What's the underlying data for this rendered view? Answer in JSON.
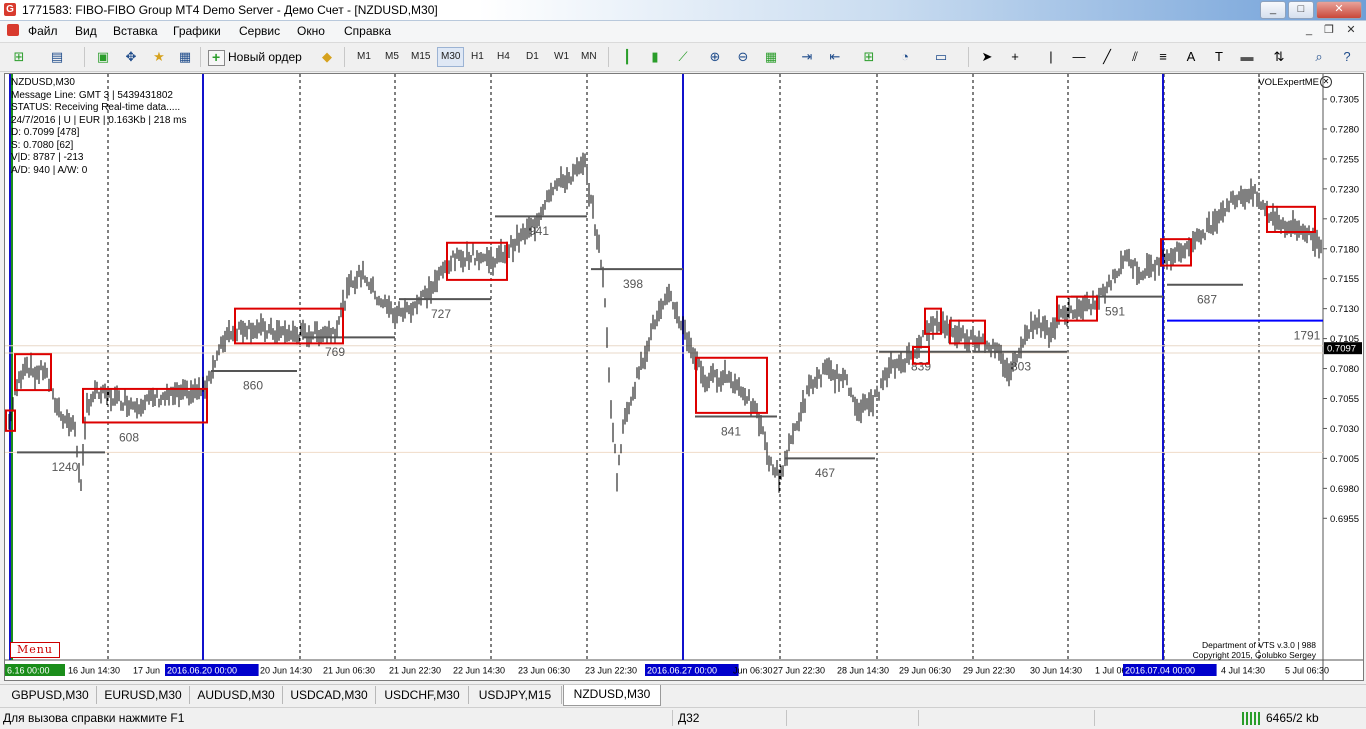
{
  "window": {
    "title": "1771583: FIBO-FIBO Group MT4 Demo Server - Демо Счет - [NZDUSD,M30]",
    "icon_letter": "G",
    "min": "_",
    "max": "□",
    "close": "✕"
  },
  "menu": [
    "Файл",
    "Вид",
    "Вставка",
    "Графики",
    "Сервис",
    "Окно",
    "Справка"
  ],
  "toolbar": {
    "new_order": "Новый ордер",
    "timeframes": [
      "M1",
      "M5",
      "M15",
      "M30",
      "H1",
      "H4",
      "D1",
      "W1",
      "MN"
    ],
    "active_timeframe": "M30"
  },
  "chart": {
    "symbol": "NZDUSD,M30",
    "info": [
      "Message Line: GMT 3 | 5439431802",
      "STATUS:  Receiving Real-time data.....",
      "24/7/2016 | U | EUR | 0.163Kb | 218 ms",
      "D: 0.7099  [478]",
      "S: 0.7080  [62]",
      "V|D: 8787 | -213",
      "A/D: 940  | A/W: 0"
    ],
    "indicator_name": "VOLExpertME",
    "dept_line1": "Department of VTS  v.3.0 | 988",
    "dept_line2": "Copyright 2015, Golubko Sergey",
    "menu_label": "Menu",
    "current_price": "0.7097",
    "price_ticks": [
      "0.7305",
      "0.7280",
      "0.7255",
      "0.7230",
      "0.7205",
      "0.7180",
      "0.7155",
      "0.7130",
      "0.7105",
      "0.7080",
      "0.7055",
      "0.7030",
      "0.7005",
      "0.6980",
      "0.6955"
    ],
    "time_labels": [
      "6.16 00:00",
      "16 Jun 14:30",
      "17 Jun",
      "2016.06.20 00:00",
      "20 Jun 14:30",
      "21 Jun 06:30",
      "21 Jun 22:30",
      "22 Jun 14:30",
      "23 Jun 06:30",
      "23 Jun 22:30",
      "2016.06.27 00:00",
      "Jun 06:30",
      "27 Jun 22:30",
      "28 Jun 14:30",
      "29 Jun 06:30",
      "29 Jun 22:30",
      "30 Jun 14:30",
      "1 Jul 06",
      "2016.07.04 00:00",
      "4 Jul 14:30",
      "5 Jul 06:30"
    ],
    "volume_labels": [
      "1240",
      "608",
      "860",
      "769",
      "727",
      "941",
      "398",
      "841",
      "467",
      "839",
      "803",
      "591",
      "687",
      "1791"
    ],
    "colors": {
      "candle": "#000000",
      "session": "#1111cc",
      "box": "#dd0000",
      "level": "#555555",
      "highlight": "#0000ff"
    }
  },
  "tabs": [
    "GBPUSD,M30",
    "EURUSD,M30",
    "AUDUSD,M30",
    "USDCAD,M30",
    "USDCHF,M30",
    "USDJPY,M15",
    "NZDUSD,M30"
  ],
  "active_tab": "NZDUSD,M30",
  "status": {
    "help": "Для вызова справки нажмите F1",
    "profile": "Д32",
    "traffic": "6465/2 kb"
  }
}
